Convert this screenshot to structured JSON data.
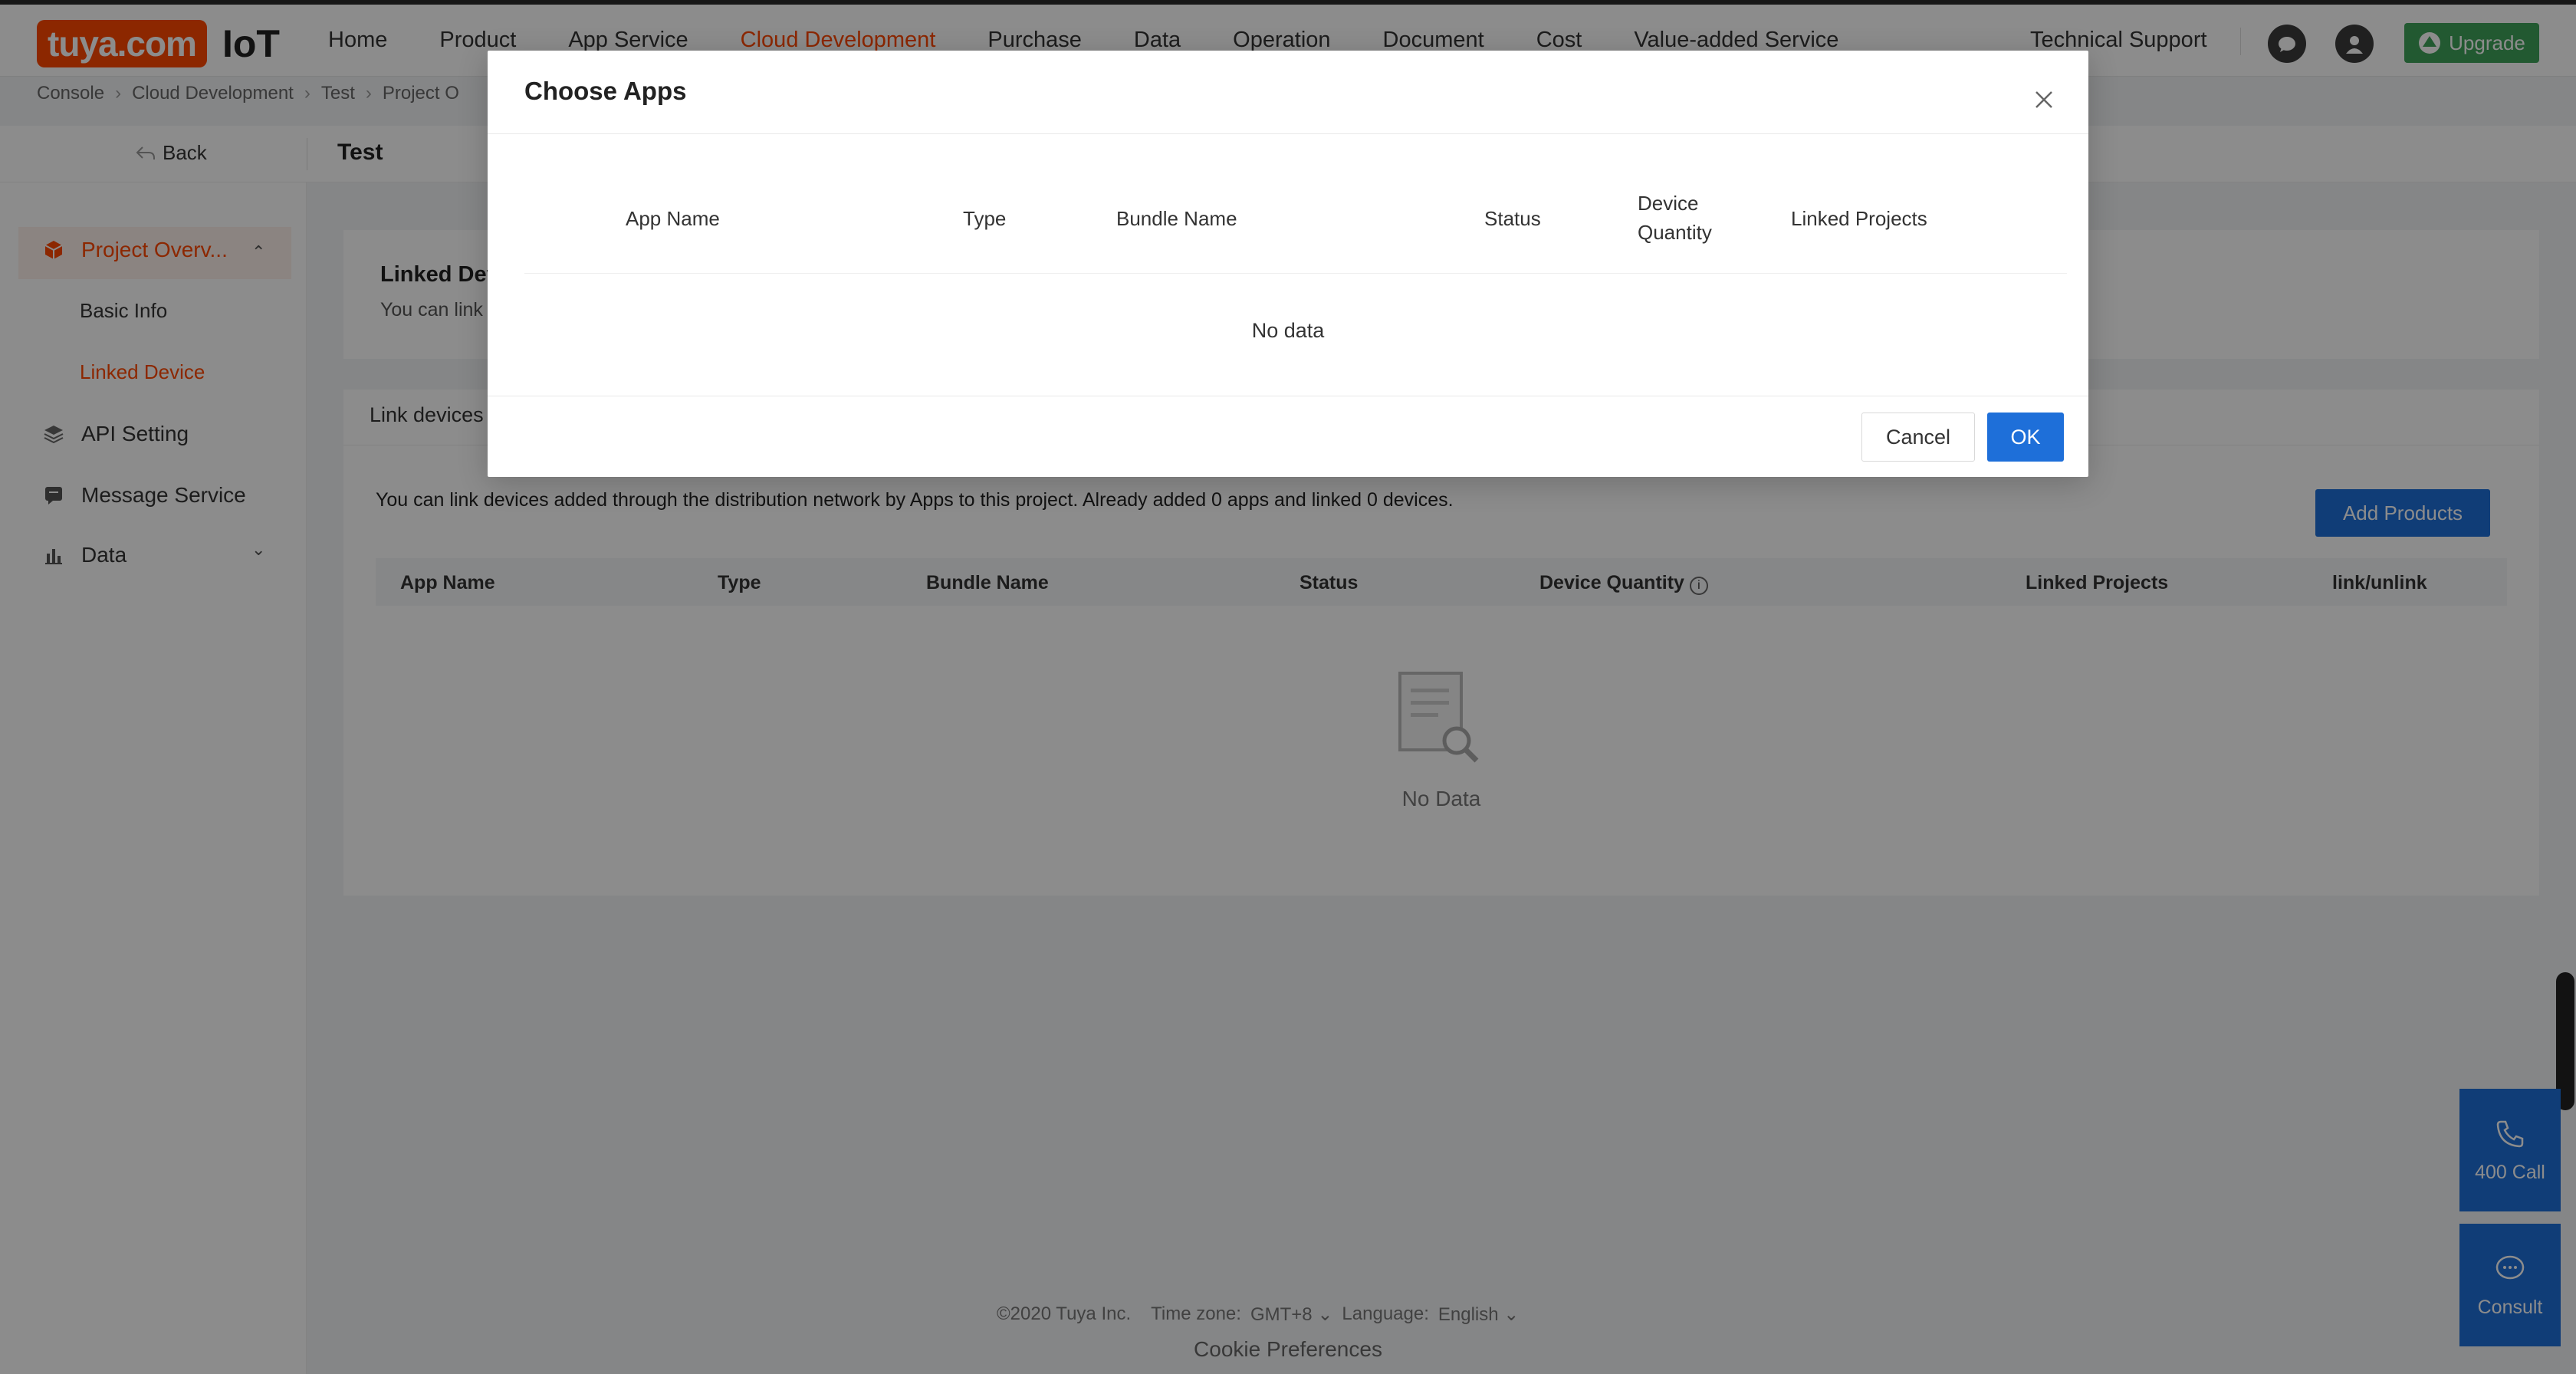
{
  "brand": {
    "logo_text": "tuya.com",
    "product": "IoT",
    "accent": "#ff4800",
    "primary": "#1e6fd9",
    "upgrade_color": "#3ea35a"
  },
  "nav": {
    "items": [
      "Home",
      "Product",
      "App Service",
      "Cloud Development",
      "Purchase",
      "Data",
      "Operation",
      "Document",
      "Cost",
      "Value-added Service"
    ],
    "active": "Cloud Development",
    "tech_support": "Technical Support",
    "upgrade": "Upgrade"
  },
  "breadcrumb": [
    "Console",
    "Cloud Development",
    "Test",
    "Project O"
  ],
  "backbar": {
    "back": "Back",
    "title": "Test"
  },
  "sidebar": {
    "project_overview": "Project Overv...",
    "basic_info": "Basic Info",
    "linked_device": "Linked Device",
    "api_setting": "API Setting",
    "message_service": "Message Service",
    "data": "Data"
  },
  "card1": {
    "title": "Linked Dev",
    "desc": "You can link"
  },
  "card2": {
    "tab": "Link devices",
    "desc": "You can link devices added through the distribution network by Apps to this project. Already added 0 apps and linked 0 devices.",
    "add_products": "Add Products",
    "columns": [
      "App Name",
      "Type",
      "Bundle Name",
      "Status",
      "Device Quantity",
      "Linked Projects",
      "link/unlink"
    ],
    "empty": "No Data"
  },
  "footer": {
    "copyright": "©2020 Tuya Inc.",
    "tz_label": "Time zone:",
    "tz_value": "GMT+8",
    "lang_label": "Language:",
    "lang_value": "English",
    "cookie": "Cookie Preferences"
  },
  "float": {
    "call": "400 Call",
    "consult": "Consult"
  },
  "modal": {
    "title": "Choose Apps",
    "columns": {
      "app_name": "App Name",
      "type": "Type",
      "bundle": "Bundle Name",
      "status": "Status",
      "device_qty_1": "Device",
      "device_qty_2": "Quantity",
      "linked": "Linked Projects"
    },
    "no_data": "No data",
    "cancel": "Cancel",
    "ok": "OK"
  }
}
